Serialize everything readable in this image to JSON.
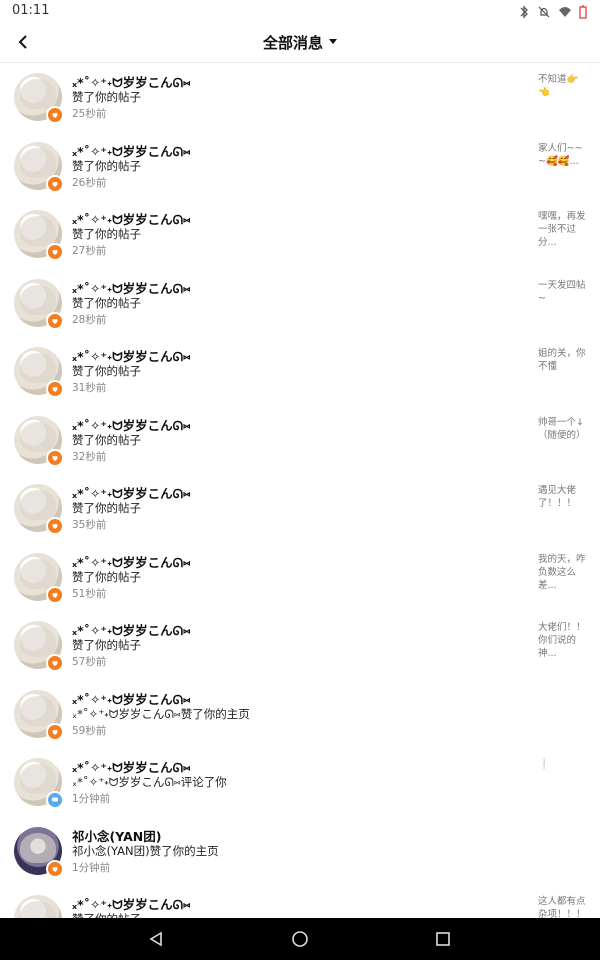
{
  "status_bar": {
    "time": "01:11",
    "icons": [
      "bluetooth-icon",
      "mute-icon",
      "wifi-icon",
      "battery-icon"
    ]
  },
  "header": {
    "title": "全部消息",
    "back_icon": "back-arrow-icon",
    "dropdown_icon": "caret-down-icon"
  },
  "items": [
    {
      "name": "ₓ*˚✧⁺˖ᗢ岁岁こんᘏ⑅",
      "action": "赞了你的帖子",
      "time": "25秒前",
      "preview": "不知道👉👈",
      "badge": "like"
    },
    {
      "name": "ₓ*˚✧⁺˖ᗢ岁岁こんᘏ⑅",
      "action": "赞了你的帖子",
      "time": "26秒前",
      "preview": "家人们~~~🥰🥰...",
      "badge": "like"
    },
    {
      "name": "ₓ*˚✧⁺˖ᗢ岁岁こんᘏ⑅",
      "action": "赞了你的帖子",
      "time": "27秒前",
      "preview": "嘿嘿，再发一张不过分...",
      "badge": "like"
    },
    {
      "name": "ₓ*˚✧⁺˖ᗢ岁岁こんᘏ⑅",
      "action": "赞了你的帖子",
      "time": "28秒前",
      "preview": "一天发四帖~",
      "badge": "like"
    },
    {
      "name": "ₓ*˚✧⁺˖ᗢ岁岁こんᘏ⑅",
      "action": "赞了你的帖子",
      "time": "31秒前",
      "preview": "姐的关，你不懂",
      "badge": "like"
    },
    {
      "name": "ₓ*˚✧⁺˖ᗢ岁岁こんᘏ⑅",
      "action": "赞了你的帖子",
      "time": "32秒前",
      "preview": "帅哥一个↓（随便的）",
      "badge": "like"
    },
    {
      "name": "ₓ*˚✧⁺˖ᗢ岁岁こんᘏ⑅",
      "action": "赞了你的帖子",
      "time": "35秒前",
      "preview": "遇见大佬了！！！",
      "badge": "like"
    },
    {
      "name": "ₓ*˚✧⁺˖ᗢ岁岁こんᘏ⑅",
      "action": "赞了你的帖子",
      "time": "51秒前",
      "preview": "我的天，咋负数这么差...",
      "badge": "like"
    },
    {
      "name": "ₓ*˚✧⁺˖ᗢ岁岁こんᘏ⑅",
      "action": "赞了你的帖子",
      "time": "57秒前",
      "preview": "大佬们！！你们说的神...",
      "badge": "like"
    },
    {
      "name": "ₓ*˚✧⁺˖ᗢ岁岁こんᘏ⑅",
      "action": "ₓ*˚✧⁺˖ᗢ岁岁こんᘏ⑅赞了你的主页",
      "time": "59秒前",
      "preview": "",
      "badge": "like"
    },
    {
      "name": "ₓ*˚✧⁺˖ᗢ岁岁こんᘏ⑅",
      "action": "ₓ*˚✧⁺˖ᗢ岁岁こんᘏ⑅评论了你",
      "time": "1分钟前",
      "preview": "❕",
      "badge": "comment"
    },
    {
      "name": "祁小念(YAN团)",
      "action": "祁小念(YAN团)赞了你的主页",
      "time": "1分钟前",
      "preview": "",
      "badge": "like",
      "avatar": "dark"
    },
    {
      "name": "ₓ*˚✧⁺˖ᗢ岁岁こんᘏ⑅",
      "action": "赞了你的帖子",
      "time": "",
      "preview": "这人都有点杂项！！！",
      "badge": "like"
    }
  ],
  "navbar": {
    "icons": [
      "back-triangle-icon",
      "home-circle-icon",
      "recents-square-icon"
    ]
  }
}
